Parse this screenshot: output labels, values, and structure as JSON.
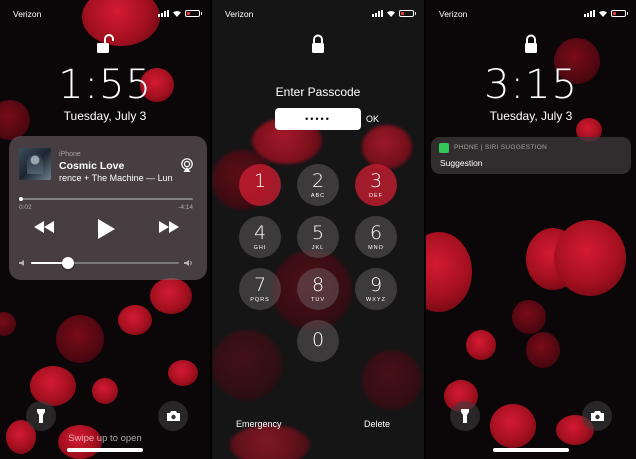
{
  "lock_screen": {
    "carrier": "Verizon",
    "time": "1:55",
    "date": "Tuesday, July 3",
    "player": {
      "source": "iPhone",
      "song": "Cosmic Love",
      "artist": "rence + The Machine — Lun",
      "elapsed": "0:02",
      "remaining": "-4:14",
      "progress": 0.01,
      "volume": 0.25
    },
    "swipe_hint": "Swipe up to open",
    "icons": [
      "unlock-icon",
      "flashlight-icon",
      "camera-icon",
      "airplay-icon",
      "rewind-icon",
      "play-icon",
      "fast-forward-icon",
      "volume-low-icon",
      "volume-high-icon"
    ]
  },
  "passcode_screen": {
    "carrier": "Verizon",
    "prompt": "Enter Passcode",
    "field_value": "•••••",
    "ok_label": "OK",
    "keys": [
      {
        "num": "1",
        "letters": "",
        "highlight": true
      },
      {
        "num": "2",
        "letters": "ABC",
        "highlight": false
      },
      {
        "num": "3",
        "letters": "DEF",
        "highlight": true
      },
      {
        "num": "4",
        "letters": "GHI",
        "highlight": false
      },
      {
        "num": "5",
        "letters": "JKL",
        "highlight": false
      },
      {
        "num": "6",
        "letters": "MNO",
        "highlight": false
      },
      {
        "num": "7",
        "letters": "PQRS",
        "highlight": false
      },
      {
        "num": "8",
        "letters": "TUV",
        "highlight": false
      },
      {
        "num": "9",
        "letters": "WXYZ",
        "highlight": false
      },
      {
        "num": "0",
        "letters": "",
        "highlight": false
      }
    ],
    "emergency_label": "Emergency",
    "delete_label": "Delete"
  },
  "suggestion_screen": {
    "carrier": "Verizon",
    "time": "3:15",
    "date": "Tuesday, July 3",
    "notification": {
      "header": "PHONE | SIRI SUGGESTION",
      "body": "Suggestion"
    }
  },
  "colors": {
    "accent_red": "#d41a33",
    "battery_low": "#ff3b30",
    "phone_green": "#34c759"
  }
}
